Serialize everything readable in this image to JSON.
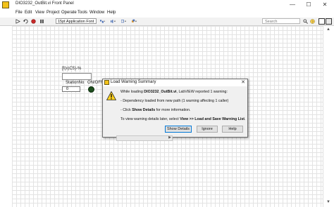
{
  "window": {
    "title": "DIO3232_OutBit.vi Front Panel",
    "min": "—",
    "max": "☐",
    "close": "✕"
  },
  "menu": [
    "File",
    "Edit",
    "View",
    "Project",
    "Operate",
    "Tools",
    "Window",
    "Help"
  ],
  "toolbar": {
    "font": "15pt Application Font",
    "search_placeholder": "Search"
  },
  "front_panel": {
    "header_label": "[f(x)C5)-%",
    "station_label": "StationNo",
    "station_value": "0",
    "onoff_label": "ON/OFF"
  },
  "dialog": {
    "title": "Load Warning Summary",
    "line1_pre": "While loading ",
    "line1_bold": "DIO3232_OutBit.vi",
    "line1_post": ", LabVIEW reported 1 warning:",
    "line2": "- Dependency loaded from new path (1 warning affecting 1 caller)",
    "line3_pre": "- Click ",
    "line3_bold": "Show Details",
    "line3_post": " for more information.",
    "line4_pre": "To view warning details later, select ",
    "line4_bold": "View >> Load and Save Warning List",
    "line4_post": ".",
    "buttons": {
      "show_details": "Show Details",
      "ignore": "Ignore",
      "help": "Help"
    }
  }
}
